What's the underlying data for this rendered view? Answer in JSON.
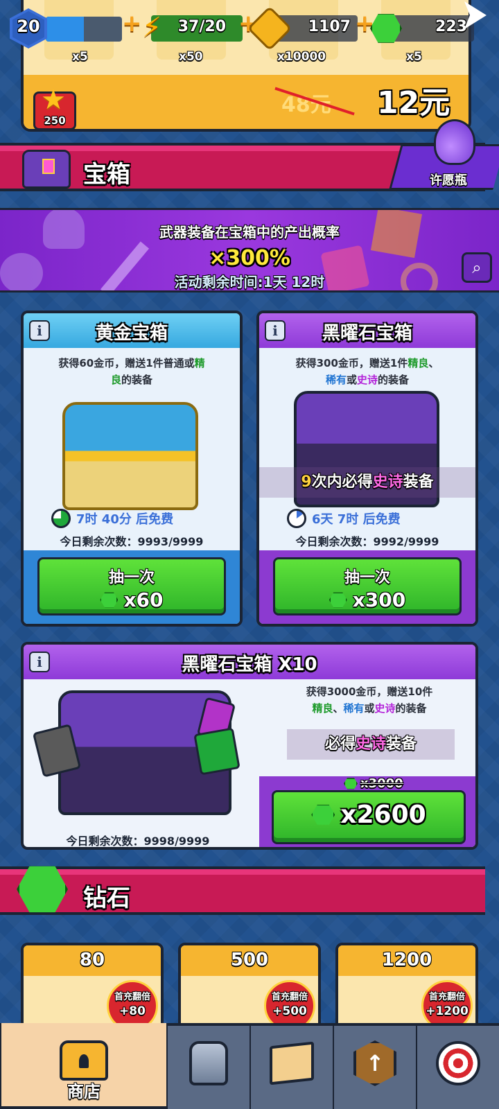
{
  "hud": {
    "level": "20",
    "xp_fraction": 0.5,
    "energy": "37/20",
    "coins": "1107",
    "gems": "223"
  },
  "offer": {
    "quantities": [
      "x5",
      "x50",
      "x10000",
      "x5"
    ],
    "old_price": "48元",
    "price": "12元",
    "badge": "250"
  },
  "chest_section": {
    "title": "宝箱",
    "wish_label": "许愿瓶"
  },
  "banner": {
    "line1": "武器装备在宝箱中的产出概率",
    "line2": "×300%",
    "line3": "活动剩余时间:1天 12时"
  },
  "gold_chest": {
    "title": "黄金宝箱",
    "desc_a": "获得60金币，赠送1件普通或",
    "desc_b": "精",
    "desc_c": "良",
    "desc_d": "的装备",
    "timer": "7时 40分 后免费",
    "remaining": "今日剩余次数：9993/9999",
    "button_label": "抽一次",
    "button_cost": "x60"
  },
  "obsidian_chest": {
    "title": "黑曜石宝箱",
    "desc_a": "获得300金币，赠送1件",
    "desc_b": "精良",
    "desc_c": "、",
    "desc_d": "稀有",
    "desc_e": "或",
    "desc_f": "史诗",
    "desc_g": "的装备",
    "guarantee_a": "9",
    "guarantee_b": "次内必得",
    "guarantee_c": "史诗",
    "guarantee_d": "装备",
    "timer": "6天 7时 后免费",
    "remaining": "今日剩余次数：9992/9999",
    "button_label": "抽一次",
    "button_cost": "x300"
  },
  "obsidian_x10": {
    "title": "黑曜石宝箱 X10",
    "desc_a": "获得3000金币，赠送10件",
    "desc_b": "精良",
    "desc_c": "、",
    "desc_d": "稀有",
    "desc_e": "或",
    "desc_f": "史诗",
    "desc_g": "的装备",
    "guarantee_a": "必得",
    "guarantee_b": "史诗",
    "guarantee_c": "装备",
    "old_cost": "x3000",
    "cost": "x2600",
    "remaining": "今日剩余次数：9998/9999"
  },
  "gem_section": {
    "title": "钻石",
    "packs": [
      {
        "amount": "80",
        "bonus_label": "首充翻倍",
        "bonus": "+80"
      },
      {
        "amount": "500",
        "bonus_label": "首充翻倍",
        "bonus": "+500"
      },
      {
        "amount": "1200",
        "bonus_label": "首充翻倍",
        "bonus": "+1200"
      }
    ]
  },
  "nav": {
    "tabs": [
      {
        "label": "商店",
        "icon": "shop-chest-icon",
        "active": true
      },
      {
        "label": "",
        "icon": "armor-icon"
      },
      {
        "label": "",
        "icon": "map-icon"
      },
      {
        "label": "",
        "icon": "upgrade-arrow-icon"
      },
      {
        "label": "",
        "icon": "target-icon"
      }
    ]
  },
  "colors": {
    "section_header": "#c81a55",
    "banner": "#8a2fd6",
    "green_button": "#3cc92e",
    "gold_card_header": "#3fb0e8",
    "obsidian_card_header": "#9a44dc"
  }
}
